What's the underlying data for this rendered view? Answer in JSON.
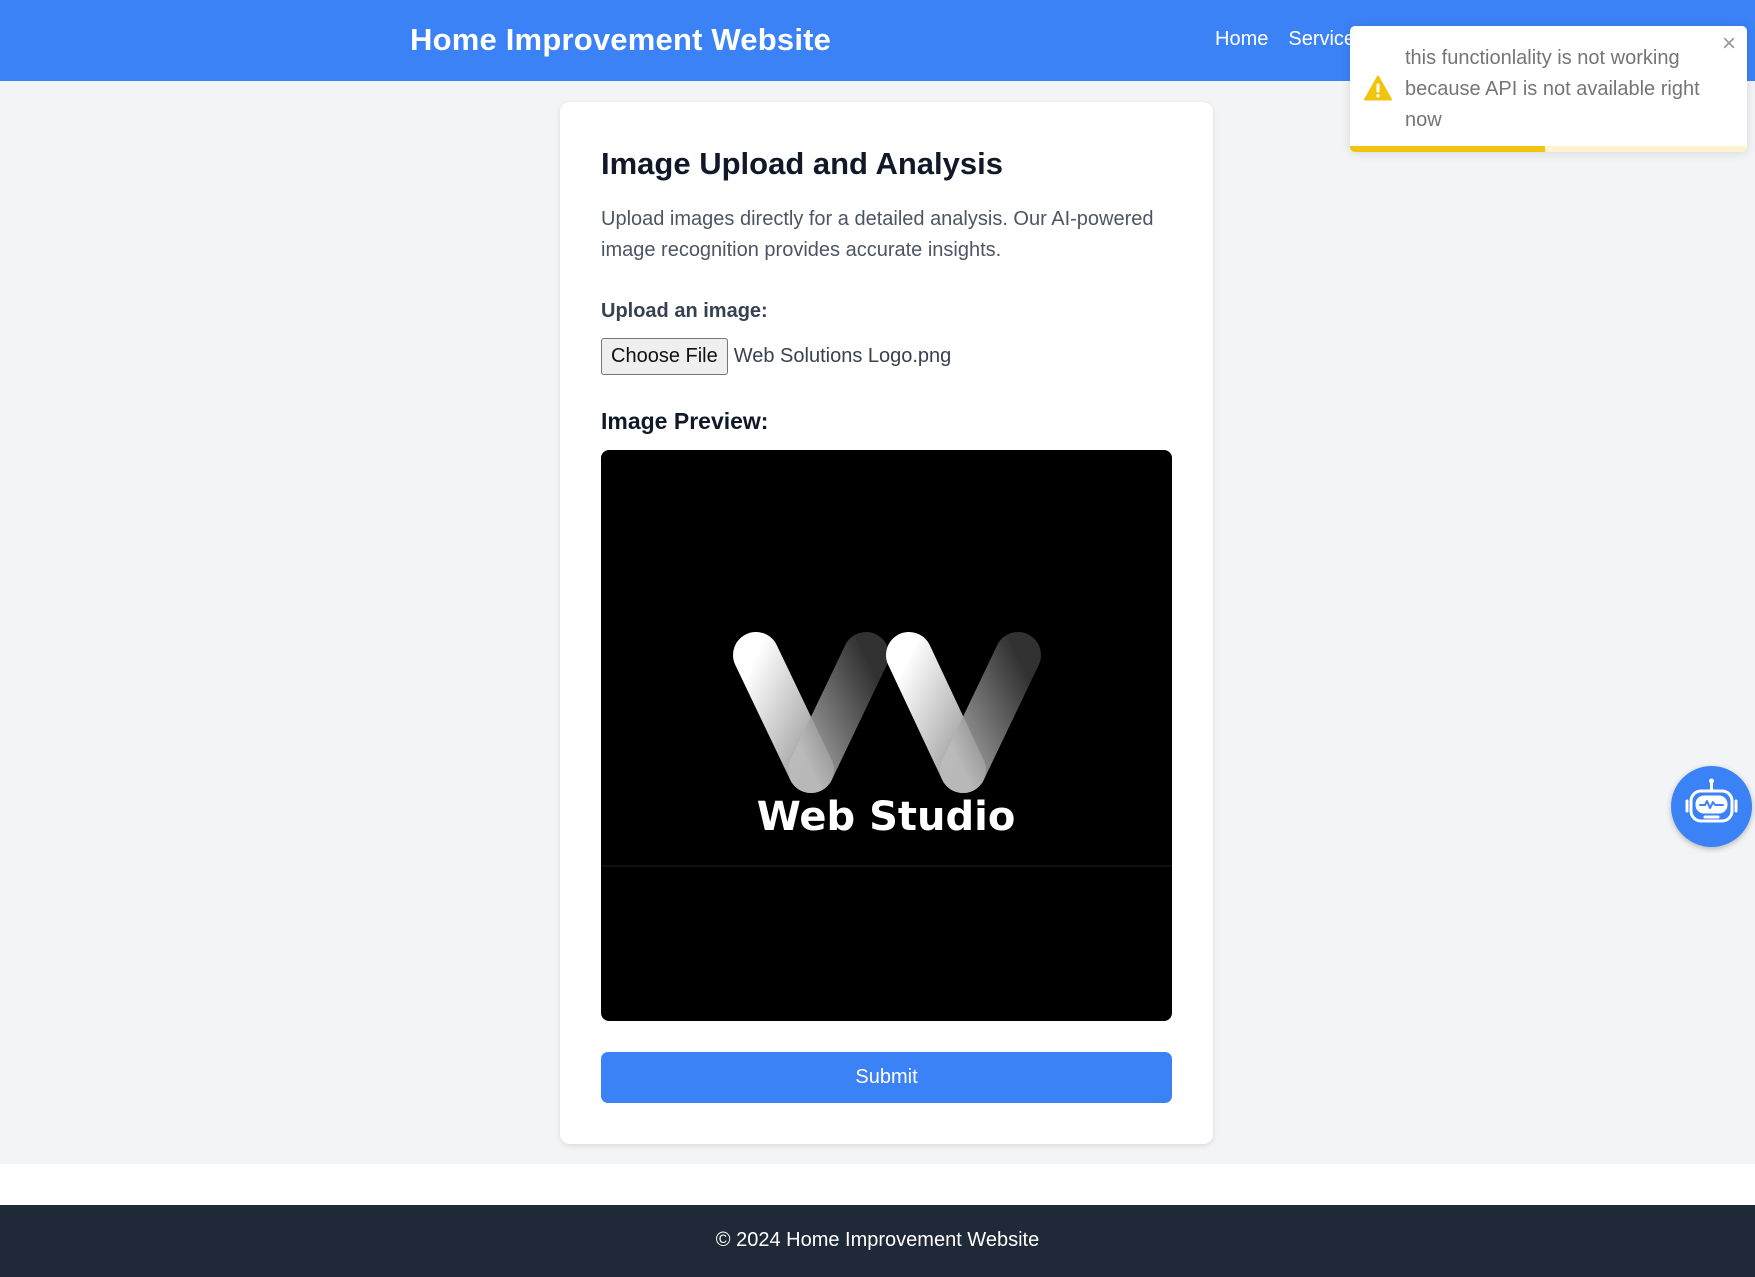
{
  "header": {
    "site_title": "Home Improvement Website",
    "nav": [
      {
        "label": "Home"
      },
      {
        "label": "Services"
      }
    ]
  },
  "main": {
    "title": "Image Upload and Analysis",
    "description": "Upload images directly for a detailed analysis. Our AI-powered image recognition provides accurate insights.",
    "upload_label": "Upload an image:",
    "file_button_label": "Choose File",
    "file_name": "Web Solutions Logo.png",
    "preview_label": "Image Preview:",
    "preview_image_text": "Web Studio",
    "submit_label": "Submit"
  },
  "footer": {
    "text": "© 2024 Home Improvement Website"
  },
  "toast": {
    "message": "this functionlality is not working because API is not available right now",
    "icon": "warning-icon",
    "close_symbol": "×",
    "progress_fraction": 0.49
  },
  "chatbot": {
    "icon": "robot-icon"
  },
  "colors": {
    "primary": "#3b82f6",
    "footer": "#1f2937",
    "background": "#f3f4f6",
    "warning": "#f1c40f"
  }
}
